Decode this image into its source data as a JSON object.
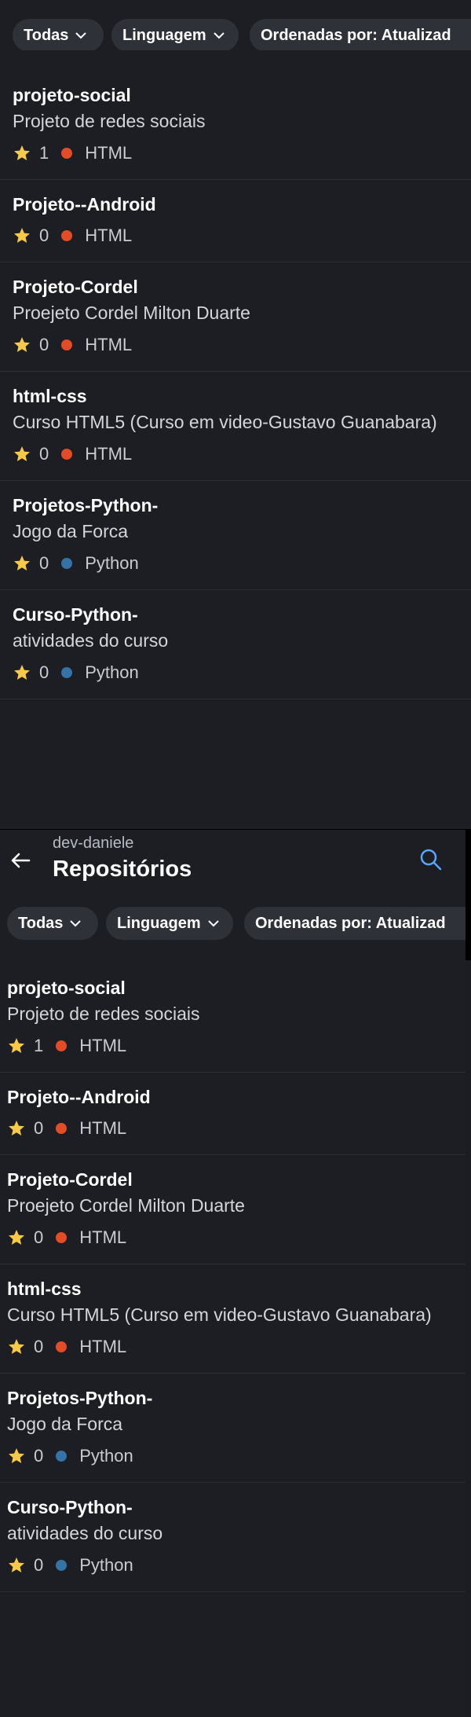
{
  "header": {
    "owner": "dev-daniele",
    "title": "Repositórios"
  },
  "filters": {
    "all_label": "Todas",
    "language_label": "Linguagem",
    "sort_label": "Ordenadas por: Atualizad"
  },
  "colors": {
    "html": "#e34c26",
    "python": "#3572a5",
    "star": "#f7c948"
  },
  "repos": [
    {
      "name": "projeto-social",
      "description": "Projeto de redes sociais",
      "stars": "1",
      "language": "HTML",
      "lang_color": "#e34c26"
    },
    {
      "name": "Projeto--Android",
      "description": "",
      "stars": "0",
      "language": "HTML",
      "lang_color": "#e34c26"
    },
    {
      "name": "Projeto-Cordel",
      "description": "Proejeto Cordel Milton Duarte",
      "stars": "0",
      "language": "HTML",
      "lang_color": "#e34c26"
    },
    {
      "name": "html-css",
      "description": "Curso HTML5 (Curso em video-Gustavo Guanabara)",
      "stars": "0",
      "language": "HTML",
      "lang_color": "#e34c26"
    },
    {
      "name": "Projetos-Python-",
      "description": "Jogo da Forca",
      "stars": "0",
      "language": "Python",
      "lang_color": "#3572a5"
    },
    {
      "name": "Curso-Python-",
      "description": "atividades do curso",
      "stars": "0",
      "language": "Python",
      "lang_color": "#3572a5"
    }
  ]
}
